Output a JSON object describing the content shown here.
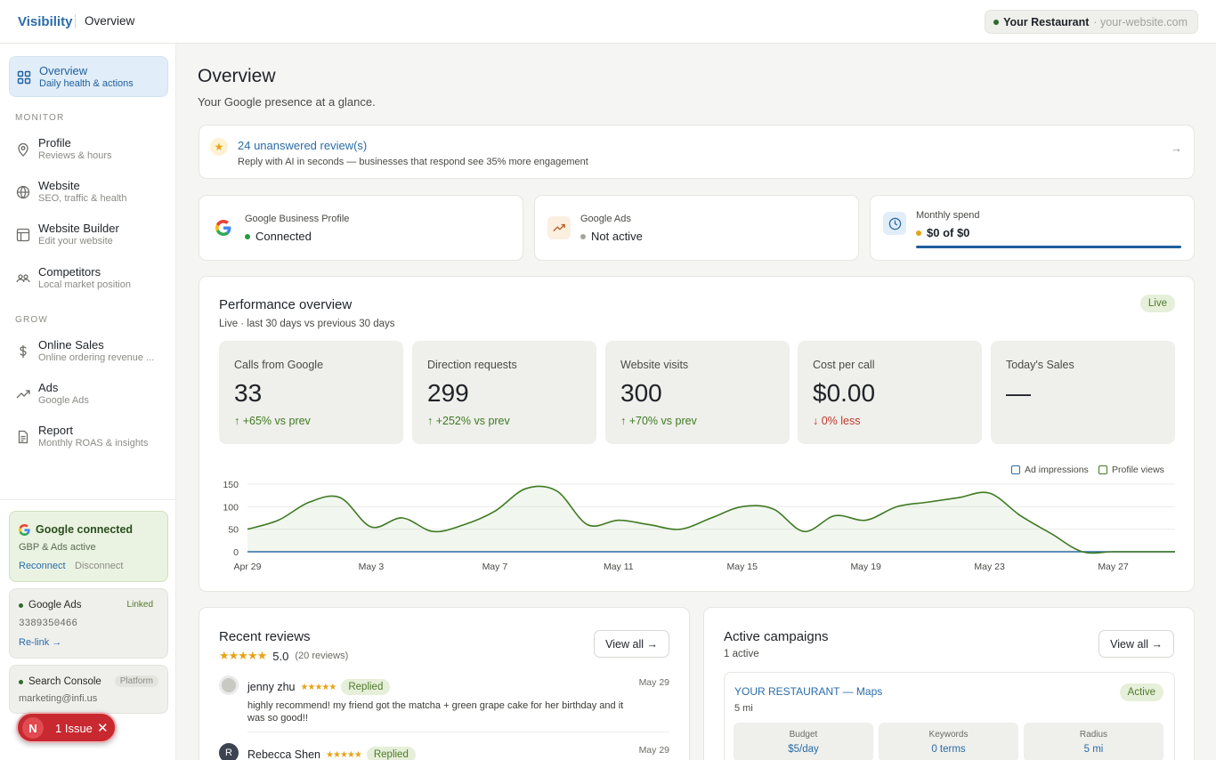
{
  "topbar": {
    "brand": "Visibility",
    "page": "Overview",
    "restaurant": "Your Restaurant",
    "website": "· your-website.com"
  },
  "sidebar": {
    "items": [
      {
        "label": "Overview",
        "sub": "Daily health & actions",
        "icon": "grid-icon"
      },
      {
        "label": "Profile",
        "sub": "Reviews & hours",
        "icon": "map-pin-icon"
      },
      {
        "label": "Website",
        "sub": "SEO, traffic & health",
        "icon": "globe-icon"
      },
      {
        "label": "Website Builder",
        "sub": "Edit your website",
        "icon": "layout-icon"
      },
      {
        "label": "Competitors",
        "sub": "Local market position",
        "icon": "users-icon"
      },
      {
        "label": "Online Sales",
        "sub": "Online ordering revenue ...",
        "icon": "dollar-icon"
      },
      {
        "label": "Ads",
        "sub": "Google Ads",
        "icon": "trending-up-icon"
      },
      {
        "label": "Report",
        "sub": "Monthly ROAS & insights",
        "icon": "document-icon"
      }
    ],
    "sections": {
      "monitor": "MONITOR",
      "grow": "GROW"
    },
    "google_card": {
      "title": "Google connected",
      "sub": "GBP & Ads active",
      "reconnect": "Reconnect",
      "disconnect": "Disconnect"
    },
    "ads_card": {
      "title": "Google Ads",
      "tag": "Linked",
      "number": "3389350466",
      "link": "Re-link →"
    },
    "console_card": {
      "title": "Search Console",
      "tag": "Platform",
      "email": "marketing@infi.us"
    },
    "issue": {
      "avatar": "N",
      "label": "1 Issue",
      "close": "✕"
    }
  },
  "main": {
    "title": "Overview",
    "subtitle": "Your Google presence at a glance."
  },
  "banner": {
    "title": "24 unanswered review(s)",
    "subtitle": "Reply with AI in seconds — businesses that respond see 35% more engagement",
    "arrow": "→",
    "icon": "star-icon"
  },
  "stats": {
    "gbp": {
      "label": "Google Business Profile",
      "value": "Connected",
      "status_color": "#1f9d3a"
    },
    "ads": {
      "label": "Google Ads",
      "value": "Not active",
      "status_color": "#a3a39e"
    },
    "spend": {
      "label": "Monthly spend",
      "value": "$0 of $0",
      "status_color": "#e8a317",
      "progress": 1.0
    }
  },
  "performance": {
    "title": "Performance overview",
    "subtitle": "Live · last 30 days vs previous 30 days",
    "badge": "Live",
    "metrics": [
      {
        "label": "Calls from Google",
        "value": "33",
        "delta": "↑ +65% vs prev",
        "dir": "up"
      },
      {
        "label": "Direction requests",
        "value": "299",
        "delta": "↑ +252% vs prev",
        "dir": "up"
      },
      {
        "label": "Website visits",
        "value": "300",
        "delta": "↑ +70% vs prev",
        "dir": "up"
      },
      {
        "label": "Cost per call",
        "value": "$0.00",
        "delta": "↓ 0% less",
        "dir": "down"
      },
      {
        "label": "Today's Sales",
        "value": "—",
        "delta": "",
        "dir": "none"
      }
    ]
  },
  "chart_data": {
    "type": "line",
    "x": [
      "Apr 29",
      "Apr 30",
      "May 1",
      "May 2",
      "May 3",
      "May 4",
      "May 5",
      "May 6",
      "May 7",
      "May 8",
      "May 9",
      "May 10",
      "May 11",
      "May 12",
      "May 13",
      "May 14",
      "May 15",
      "May 16",
      "May 17",
      "May 18",
      "May 19",
      "May 20",
      "May 21",
      "May 22",
      "May 23",
      "May 24",
      "May 25",
      "May 26",
      "May 27",
      "May 28",
      "May 29"
    ],
    "x_ticks": [
      "Apr 29",
      "May 3",
      "May 7",
      "May 11",
      "May 15",
      "May 19",
      "May 23",
      "May 27"
    ],
    "y_ticks": [
      "0",
      "50",
      "100",
      "150"
    ],
    "ylim": [
      0,
      150
    ],
    "legend": [
      "Ad impressions",
      "Profile views"
    ],
    "legend_placement": "top-right",
    "series": [
      {
        "name": "Ad impressions",
        "color": "#2a6ca8",
        "values": [
          0,
          0,
          0,
          0,
          0,
          0,
          0,
          0,
          0,
          0,
          0,
          0,
          0,
          0,
          0,
          0,
          0,
          0,
          0,
          0,
          0,
          0,
          0,
          0,
          0,
          0,
          0,
          0,
          0,
          0,
          0
        ]
      },
      {
        "name": "Profile views",
        "color": "#3f7a22",
        "values": [
          50,
          70,
          110,
          120,
          55,
          75,
          45,
          60,
          90,
          140,
          135,
          60,
          70,
          60,
          50,
          75,
          100,
          95,
          45,
          80,
          70,
          100,
          110,
          120,
          130,
          80,
          40,
          0,
          0,
          0,
          0
        ]
      }
    ]
  },
  "reviews": {
    "title": "Recent reviews",
    "rating": "5.0",
    "count": "(20 reviews)",
    "view_all": "View all →",
    "stars": "★★★★★",
    "items": [
      {
        "name": "jenny zhu",
        "stars": "★★★★★",
        "status": "Replied",
        "date": "May 29",
        "text": "highly recommend! my friend got the matcha + green grape cake for her birthday and it was so good!!",
        "avatar_color": "#c9c9c4",
        "initial": ""
      },
      {
        "name": "Rebecca Shen",
        "stars": "★★★★★",
        "status": "Replied",
        "date": "May 29",
        "text": "",
        "avatar_color": "#3d4450",
        "initial": "R"
      }
    ]
  },
  "campaigns": {
    "title": "Active campaigns",
    "count": "1 active",
    "view_all": "View all →",
    "items": [
      {
        "name": "YOUR RESTAURANT — Maps",
        "radius_text": "5 mi",
        "status": "Active",
        "budget_label": "Budget",
        "budget": "$5/day",
        "keywords_label": "Keywords",
        "keywords": "0 terms",
        "radius_label": "Radius",
        "radius": "5 mi"
      }
    ]
  },
  "colors": {
    "accent": "#2a6ca8",
    "green": "#3f7a22",
    "red": "#c0392b"
  }
}
